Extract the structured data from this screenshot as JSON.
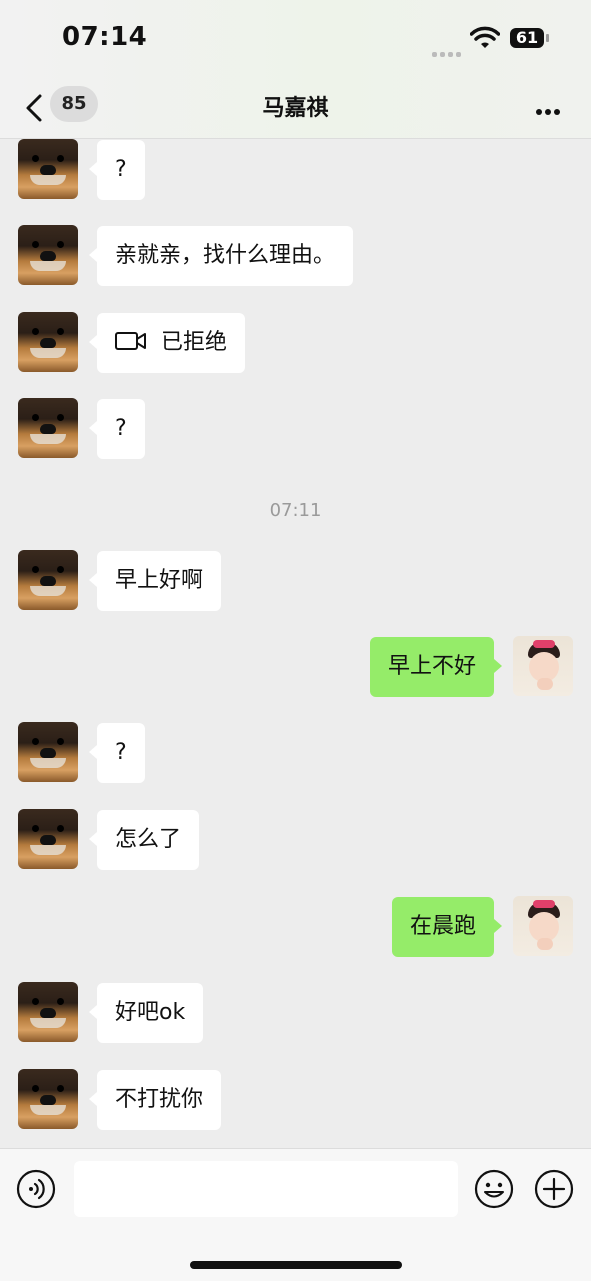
{
  "status_bar": {
    "time": "07:14",
    "battery": "61"
  },
  "nav": {
    "unread_count": "85",
    "title": "马嘉祺"
  },
  "messages": [
    {
      "side": "left",
      "text": "?"
    },
    {
      "side": "left",
      "text": "亲就亲，找什么理由。"
    },
    {
      "side": "left",
      "text": "已拒绝",
      "icon": "video-call-icon"
    },
    {
      "side": "left",
      "text": "?"
    },
    {
      "side": "left",
      "text": "早上好啊"
    },
    {
      "side": "right",
      "text": "早上不好"
    },
    {
      "side": "left",
      "text": "?"
    },
    {
      "side": "left",
      "text": "怎么了"
    },
    {
      "side": "right",
      "text": "在晨跑"
    },
    {
      "side": "left",
      "text": "好吧ok"
    },
    {
      "side": "left",
      "text": "不打扰你"
    }
  ],
  "timestamp": "07:11",
  "colors": {
    "outgoing_bubble": "#95ec69",
    "incoming_bubble": "#ffffff",
    "background": "#ededed"
  },
  "input_bar": {
    "icons": [
      "voice-icon",
      "emoji-icon",
      "plus-icon"
    ]
  }
}
